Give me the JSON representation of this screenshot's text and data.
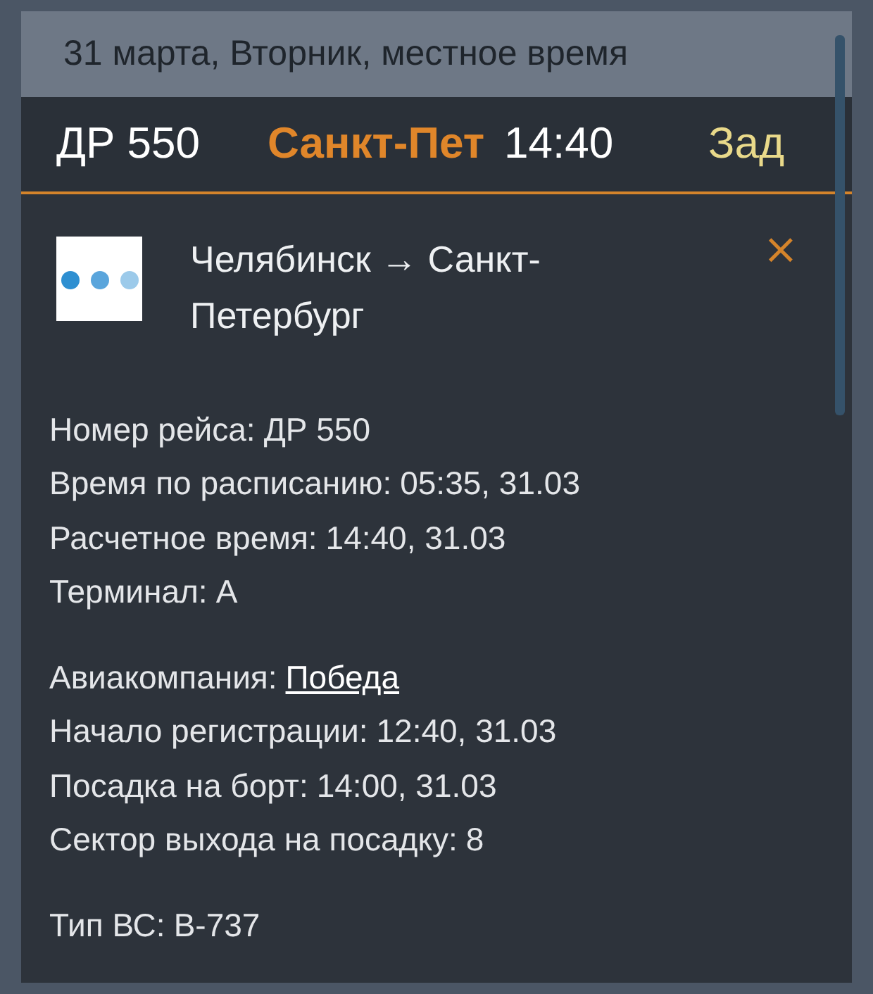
{
  "date_bar": {
    "text": "31 марта, Вторник, местное время"
  },
  "flight_row": {
    "flight": "ДР 550",
    "destination": "Санкт-Пет",
    "time": "14:40",
    "status": "Зад"
  },
  "details": {
    "route": "Челябинск → Санкт-Петербург",
    "close": "×",
    "groups": [
      [
        {
          "kind": "text",
          "label": "Номер рейса:",
          "value": "ДР 550"
        },
        {
          "kind": "text",
          "label": "Время по расписанию:",
          "value": "05:35, 31.03"
        },
        {
          "kind": "text",
          "label": "Расчетное время:",
          "value": "14:40, 31.03"
        },
        {
          "kind": "text",
          "label": "Терминал:",
          "value": "A"
        }
      ],
      [
        {
          "kind": "link",
          "label": "Авиакомпания:",
          "value": "Победа"
        },
        {
          "kind": "text",
          "label": "Начало регистрации:",
          "value": "12:40, 31.03"
        },
        {
          "kind": "text",
          "label": "Посадка на борт:",
          "value": "14:00, 31.03"
        },
        {
          "kind": "text",
          "label": "Сектор выхода на посадку:",
          "value": "8"
        }
      ],
      [
        {
          "kind": "text",
          "label": "Тип ВС:",
          "value": "B-737"
        }
      ]
    ]
  }
}
